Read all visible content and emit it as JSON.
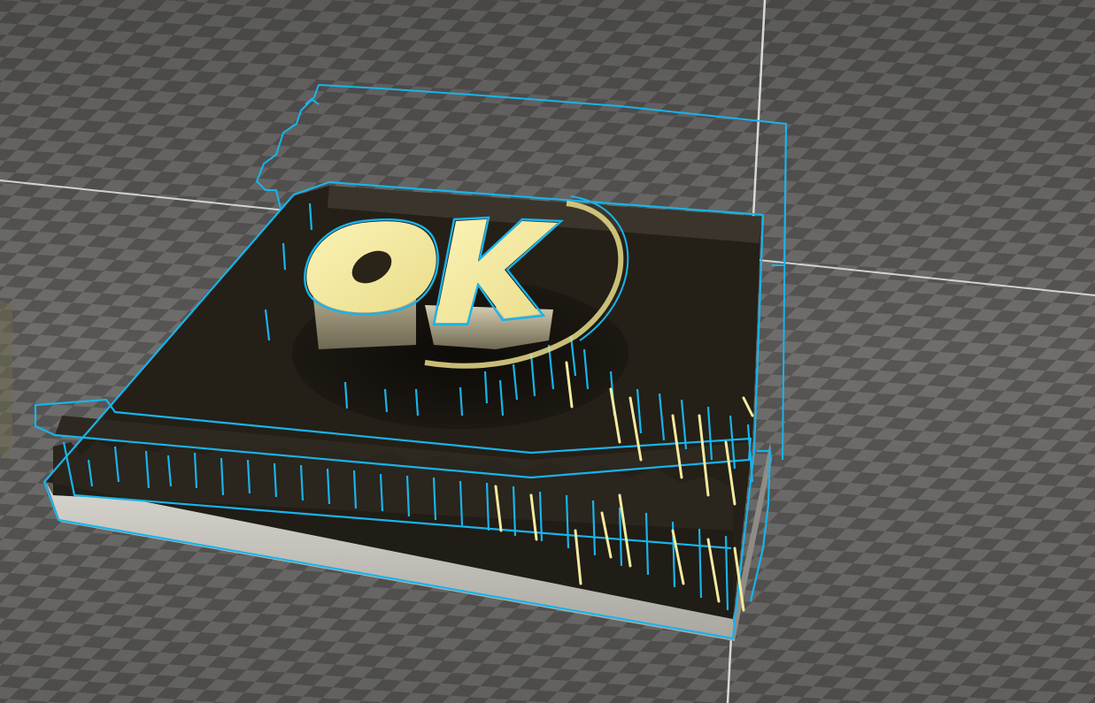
{
  "viewport": {
    "type": "3d-slicer-preview",
    "model_text": "OK",
    "colors": {
      "checker_light": "#6f6e6c",
      "checker_dark": "#575654",
      "axis_line": "#e6e6e6",
      "outline": "#18b4ea",
      "model_face": "#f3eb9e",
      "model_side": "#b9b29a",
      "base_top": "#241f17",
      "base_side": "#bfbcb6"
    }
  }
}
